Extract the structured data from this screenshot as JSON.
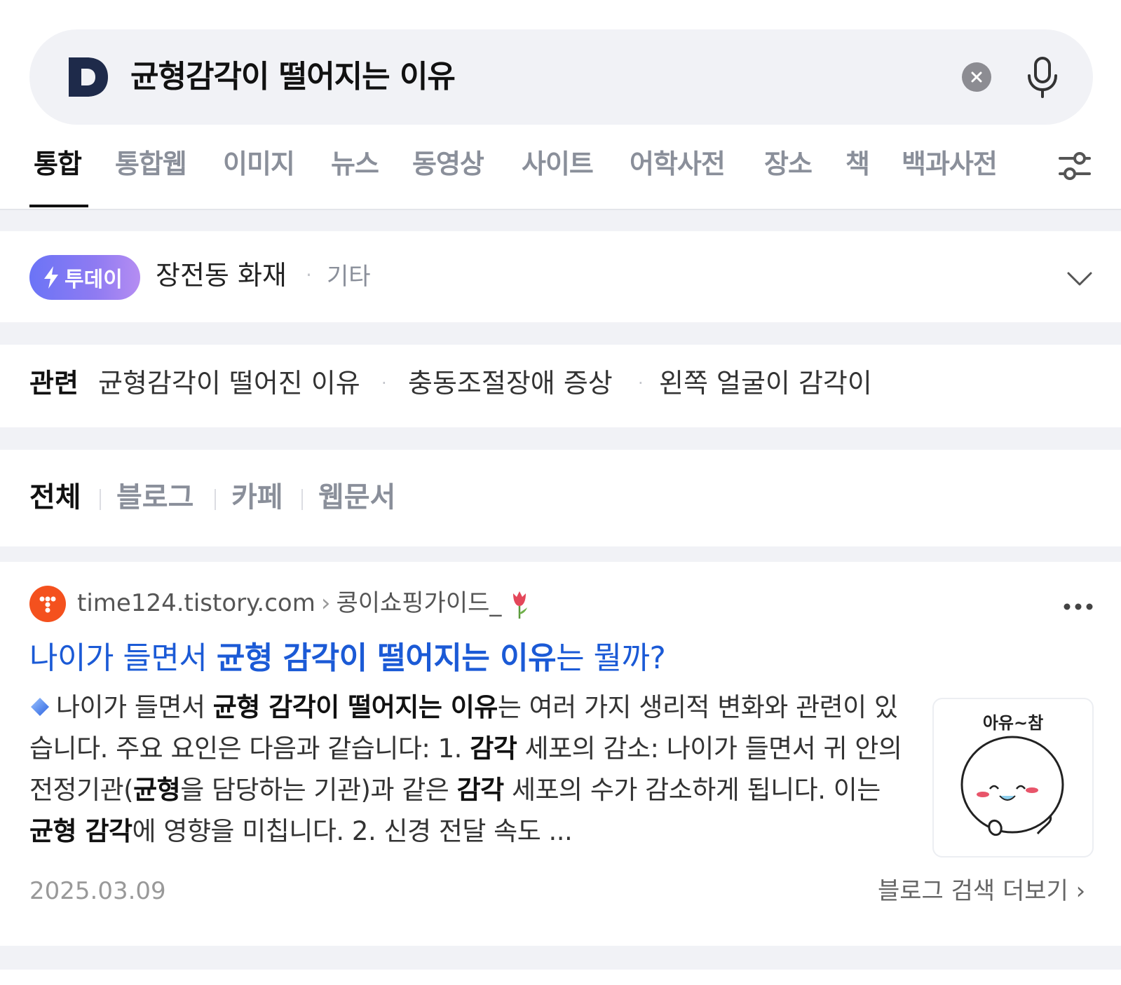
{
  "search": {
    "query": "균형감각이 떨어지는 이유",
    "logo_letter": "D"
  },
  "tabs": [
    {
      "label": "통합",
      "active": true
    },
    {
      "label": "통합웹"
    },
    {
      "label": "이미지"
    },
    {
      "label": "뉴스"
    },
    {
      "label": "동영상"
    },
    {
      "label": "사이트"
    },
    {
      "label": "어학사전"
    },
    {
      "label": "장소"
    },
    {
      "label": "책"
    },
    {
      "label": "백과사전"
    }
  ],
  "today": {
    "badge": "투데이",
    "title": "장전동 화재",
    "category": "기타"
  },
  "related": {
    "label": "관련",
    "items": [
      "균형감각이 떨어진 이유",
      "충동조절장애 증상",
      "왼쪽 얼굴이 감각이"
    ]
  },
  "subfilter": {
    "items": [
      "전체",
      "블로그",
      "카페",
      "웹문서"
    ],
    "active": "전체"
  },
  "result": {
    "domain": "time124.tistory.com",
    "blog_name": "콩이쇼핑가이드_",
    "title_pre": "나이가 들면서 ",
    "title_bold": "균형 감각이 떨어지는 이유",
    "title_post": "는 뭘까?",
    "snippet": {
      "s1": "나이가 들면서 ",
      "b1": "균형 감각이 떨어지는 이유",
      "s2": "는 여러 가지 생리적 변화와 관련이 있습니다. 주요 요인은 다음과 같습니다: 1. ",
      "b2": "감각",
      "s3": " 세포의 감소: 나이가 들면서 귀 안의 전정기관(",
      "b3": "균형",
      "s4": "을 담당하는 기관)과 같은 ",
      "b4": "감각",
      "s5": " 세포의 수가 감소하게 됩니다. 이는 ",
      "b5": "균형 감각",
      "s6": "에 영향을 미칩니다. 2. 신경 전달 속도 ..."
    },
    "thumbnail_caption": "아유~참",
    "date": "2025.03.09",
    "more_label": "블로그 검색 더보기"
  },
  "colors": {
    "link": "#1b5ad6",
    "badge_start": "#6b74f6",
    "badge_end": "#b58df2",
    "favicon": "#f4511e",
    "background": "#f1f2f6"
  }
}
